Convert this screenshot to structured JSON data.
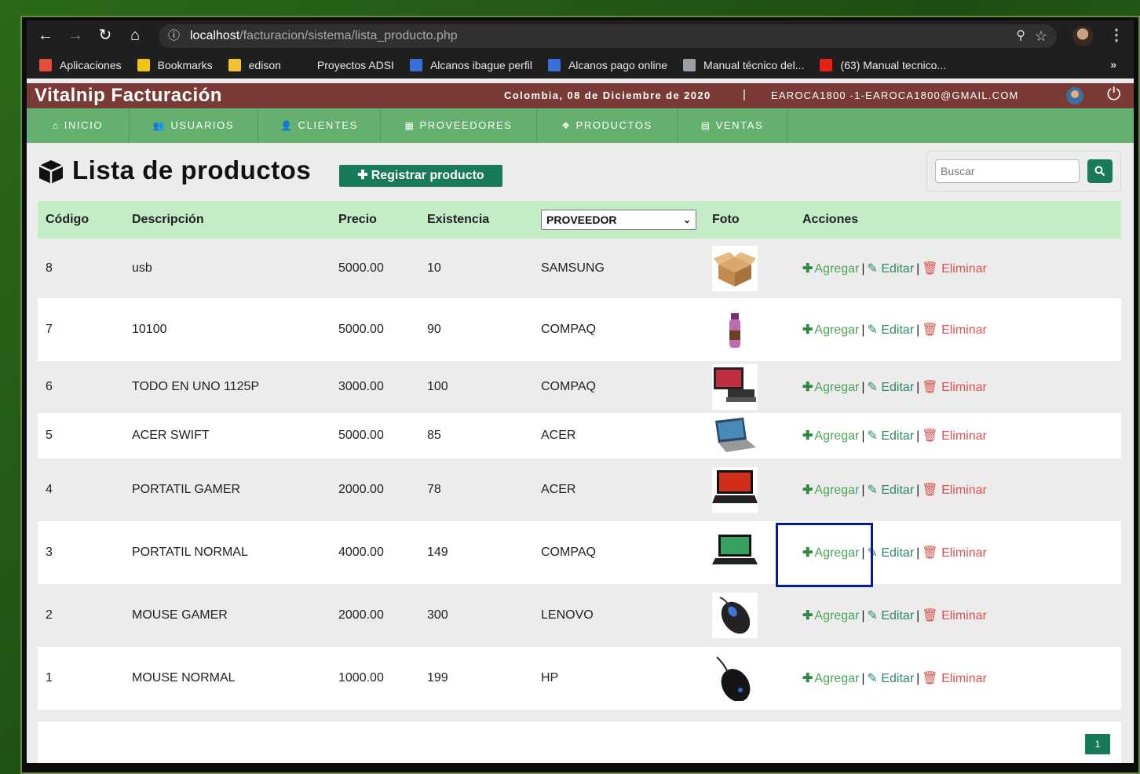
{
  "browser": {
    "url_host": "localhost",
    "url_path": "/facturacion/sistema/lista_producto.php",
    "bookmarks": [
      {
        "label": "Aplicaciones",
        "color": "#e84c3d"
      },
      {
        "label": "Bookmarks",
        "color": "#f3c316"
      },
      {
        "label": "edison",
        "color": "#f2c230"
      },
      {
        "label": "Proyectos ADSI",
        "color": "#1f1f1f"
      },
      {
        "label": "Alcanos ibague perfil",
        "color": "#3a6fd8"
      },
      {
        "label": "Alcanos pago online",
        "color": "#3a6fd8"
      },
      {
        "label": "Manual técnico del...",
        "color": "#9aa0a6"
      },
      {
        "label": "(63) Manual tecnico...",
        "color": "#e62117"
      }
    ]
  },
  "app": {
    "brand": "Vitalnip Facturación",
    "date": "Colombia, 08 de Diciembre de 2020",
    "separator": "|",
    "user": "EAROCA1800 -1-EAROCA1800@GMAIL.COM"
  },
  "menu": [
    {
      "label": "INICIO",
      "icon": "home-icon",
      "glyph": "⌂"
    },
    {
      "label": "USUARIOS",
      "icon": "users-icon",
      "glyph": "👥"
    },
    {
      "label": "CLIENTES",
      "icon": "user-icon",
      "glyph": "👤"
    },
    {
      "label": "PROVEEDORES",
      "icon": "building-icon",
      "glyph": "▦"
    },
    {
      "label": "PRODUCTOS",
      "icon": "cubes-icon",
      "glyph": "❖"
    },
    {
      "label": "VENTAS",
      "icon": "document-icon",
      "glyph": "▤"
    }
  ],
  "page": {
    "title": "Lista de productos",
    "register_button": "Registrar producto",
    "search_placeholder": "Buscar"
  },
  "table": {
    "headers": {
      "codigo": "Código",
      "descripcion": "Descripción",
      "precio": "Precio",
      "existencia": "Existencia",
      "proveedor": "PROVEEDOR",
      "foto": "Foto",
      "acciones": "Acciones"
    },
    "rows": [
      {
        "codigo": "8",
        "descripcion": "usb",
        "precio": "5000.00",
        "existencia": "10",
        "proveedor": "SAMSUNG",
        "foto": "cardboard-box"
      },
      {
        "codigo": "7",
        "descripcion": "10100",
        "precio": "5000.00",
        "existencia": "90",
        "proveedor": "COMPAQ",
        "foto": "bottle"
      },
      {
        "codigo": "6",
        "descripcion": "TODO EN UNO 1125P",
        "precio": "3000.00",
        "existencia": "100",
        "proveedor": "COMPAQ",
        "foto": "all-in-one-pc"
      },
      {
        "codigo": "5",
        "descripcion": "ACER SWIFT",
        "precio": "5000.00",
        "existencia": "85",
        "proveedor": "ACER",
        "foto": "laptop"
      },
      {
        "codigo": "4",
        "descripcion": "PORTATIL GAMER",
        "precio": "2000.00",
        "existencia": "78",
        "proveedor": "ACER",
        "foto": "gaming-laptop"
      },
      {
        "codigo": "3",
        "descripcion": "PORTATIL NORMAL",
        "precio": "4000.00",
        "existencia": "149",
        "proveedor": "COMPAQ",
        "foto": "laptop-green"
      },
      {
        "codigo": "2",
        "descripcion": "MOUSE GAMER",
        "precio": "2000.00",
        "existencia": "300",
        "proveedor": "LENOVO",
        "foto": "gaming-mouse"
      },
      {
        "codigo": "1",
        "descripcion": "MOUSE NORMAL",
        "precio": "1000.00",
        "existencia": "199",
        "proveedor": "HP",
        "foto": "mouse"
      }
    ],
    "actions": {
      "add": "Agregar",
      "edit": "Editar",
      "delete": "Eliminar",
      "sep": "|"
    }
  },
  "pagination": {
    "current": "1"
  },
  "colors": {
    "header": "#7a3b36",
    "menu": "#66b06f",
    "accent": "#187a5a",
    "table_head": "#c4ecc7",
    "danger": "#d9534f"
  }
}
